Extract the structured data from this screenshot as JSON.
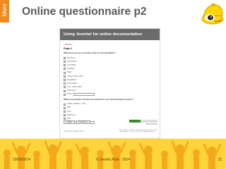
{
  "slide": {
    "side_label": "More",
    "title": "Online questionnaire p2",
    "footer_date": "19/09/2014",
    "footer_center": "© Joomla Pole - 2014",
    "page_number": "15"
  },
  "colors": {
    "accent_orange": "#f08a1c",
    "crowd_yellow": "#ffd33a",
    "form_header": "#6b6b6b"
  },
  "form": {
    "header_title": "Using Joomla! for online documentation",
    "required_note": "* Required",
    "page_label": "Page 2",
    "question1": {
      "text": "What tools are you currently using for documentation? *",
      "options": [
        "MS Word",
        "OpenOffice",
        "LibreOffice",
        "DocBook",
        "Paper",
        "oXygen XML Author",
        "PageMaker",
        "FrameMaker",
        "Text / HTML editor",
        "Nothing yet",
        "Other:"
      ]
    },
    "question2": {
      "text": "Which presentation formats are important to your documentation project?",
      "options": [
        "HTML / XHTML + CSS",
        "PDF",
        "DOC",
        "Markdown",
        "Wiki",
        "Other:"
      ]
    },
    "buttons": {
      "back": "« Back",
      "continue": "Continue »"
    },
    "progress": {
      "percent": 40,
      "label": "40% completed"
    },
    "powered_by": "Powered by Google Forms",
    "footer_note": "This content is neither created nor endorsed by Google.",
    "footer_links": "Report Abuse - Terms of Service - Additional Terms"
  },
  "icons": {
    "mascot": "joomla-mascot-hardhat-icon"
  }
}
